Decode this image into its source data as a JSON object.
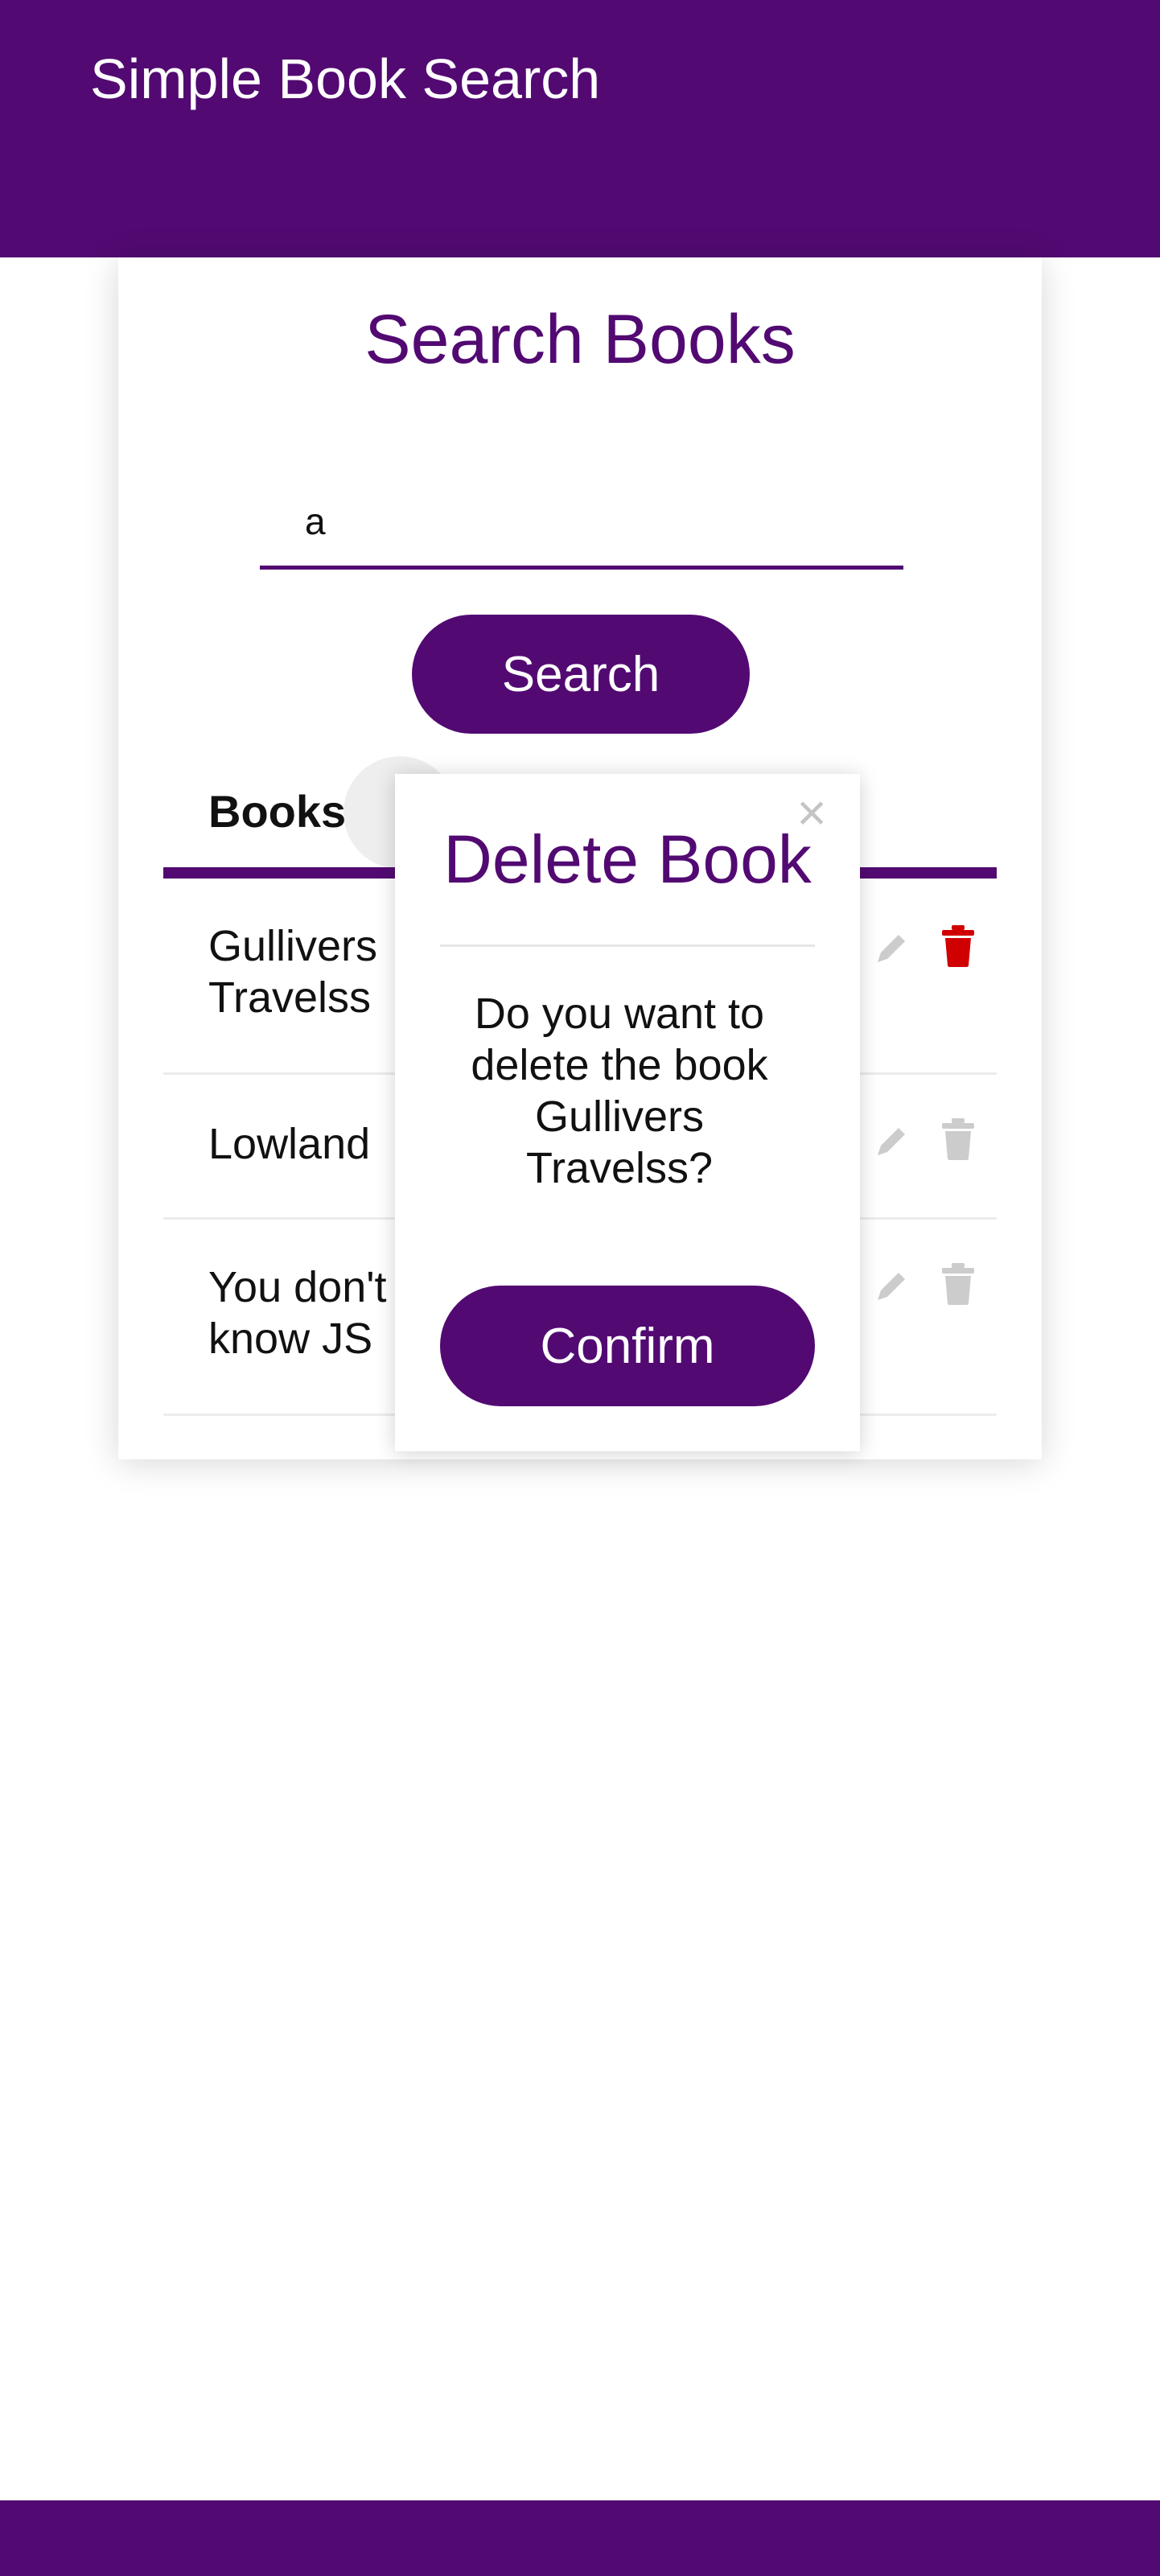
{
  "app": {
    "title": "Simple Book Search"
  },
  "search": {
    "heading": "Search Books",
    "query": "a",
    "button_label": "Search"
  },
  "tabs": {
    "books_label": "Books"
  },
  "books": [
    {
      "title_line1": "Gullivers",
      "title_line2": "Travelss",
      "delete_active": true
    },
    {
      "title_line1": "Lowland",
      "title_line2": "",
      "delete_active": false
    },
    {
      "title_line1": "You don't",
      "title_line2": "know JS",
      "delete_active": false
    }
  ],
  "modal": {
    "title": "Delete Book",
    "close_symbol": "×",
    "message_line1": "Do you want to",
    "message_line2": "delete the book",
    "message_line3": "Gullivers",
    "message_line4": "Travelss?",
    "confirm_label": "Confirm"
  },
  "icons": {
    "edit": "pencil-icon",
    "delete": "trash-icon",
    "close": "close-icon"
  },
  "colors": {
    "brand": "#520a72",
    "delete_active": "#d00000",
    "icon_muted": "#cccccc",
    "close_muted": "#c4c4c4"
  }
}
